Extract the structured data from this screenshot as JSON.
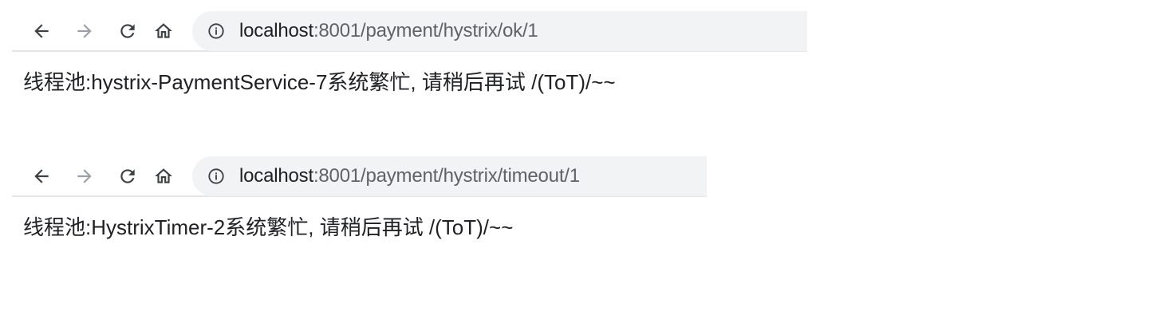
{
  "windows": [
    {
      "url_host": "localhost",
      "url_path": ":8001/payment/hystrix/ok/1",
      "page_text": "线程池:hystrix-PaymentService-7系统繁忙, 请稍后再试 /(ToT)/~~"
    },
    {
      "url_host": "localhost",
      "url_path": ":8001/payment/hystrix/timeout/1",
      "page_text": "线程池:HystrixTimer-2系统繁忙, 请稍后再试 /(ToT)/~~"
    }
  ],
  "icons": {
    "back": "back-arrow-icon",
    "forward": "forward-arrow-icon",
    "reload": "reload-icon",
    "home": "home-icon",
    "info": "info-icon"
  },
  "colors": {
    "omnibox_bg": "#f1f3f4",
    "text": "#202124",
    "muted": "#5f6368",
    "divider": "#e5e6e8"
  }
}
